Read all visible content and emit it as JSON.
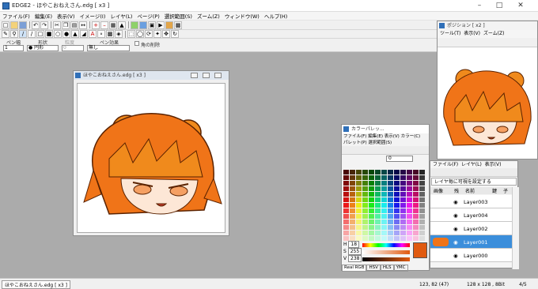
{
  "app": {
    "title": "EDGE2 - ほやこおねえさん.edg [ x3 ]"
  },
  "menu": [
    "ファイル(F)",
    "編集(E)",
    "表示(V)",
    "イメージ(I)",
    "レイヤ(L)",
    "ページ(P)",
    "選択範囲(S)",
    "ズーム(Z)",
    "ウィンドウ(W)",
    "ヘルプ(H)"
  ],
  "props": {
    "pen_label": "ペン幅",
    "pen_value": "1",
    "shape_label": "形状",
    "shape_value": "● 円形",
    "dither_label": "粒度",
    "dither_value": "0",
    "effect_label": "ペン効果",
    "effect_value": "無し",
    "checkbox_label": "角の削除"
  },
  "canvas_window": {
    "title": "ほやこおねえさん.edg [ x3 ]"
  },
  "preview_window": {
    "title": "ポジション [ x2 ]",
    "menu": [
      "ツール(T)",
      "表示(V)",
      "ズーム(Z)"
    ]
  },
  "color_window": {
    "title": "カラーパレッ...",
    "menu_row1": [
      "ファイル(F)",
      "編集(E)",
      "表示(V)",
      "カラー(C)"
    ],
    "menu_row2": [
      "パレット(P)",
      "選択範囲(S)"
    ],
    "select_value": "0",
    "h_value": "18",
    "s_value": "255",
    "v_value": "238",
    "tabs": [
      "Real RGB",
      "HSV",
      "HLS",
      "YMC"
    ]
  },
  "layer_window": {
    "menu": [
      "ファイル(F)",
      "レイヤ(L)",
      "表示(V)"
    ],
    "mode": "レイヤ毎に可視を設定する",
    "headers": [
      "画像",
      "残",
      "名前",
      "鍵",
      "子"
    ],
    "layers": [
      "Layer003",
      "Layer004",
      "Layer002",
      "Layer001",
      "Layer000"
    ]
  },
  "status": {
    "doc_tab": "ほやこおねえさん.edg [ x3 ]",
    "coords": "123, 82 (47)",
    "size": "128 x 128 , 8Bit",
    "page": "4/5"
  },
  "colors": {
    "accent": "#e05a10",
    "selected": "#3b8edb"
  }
}
